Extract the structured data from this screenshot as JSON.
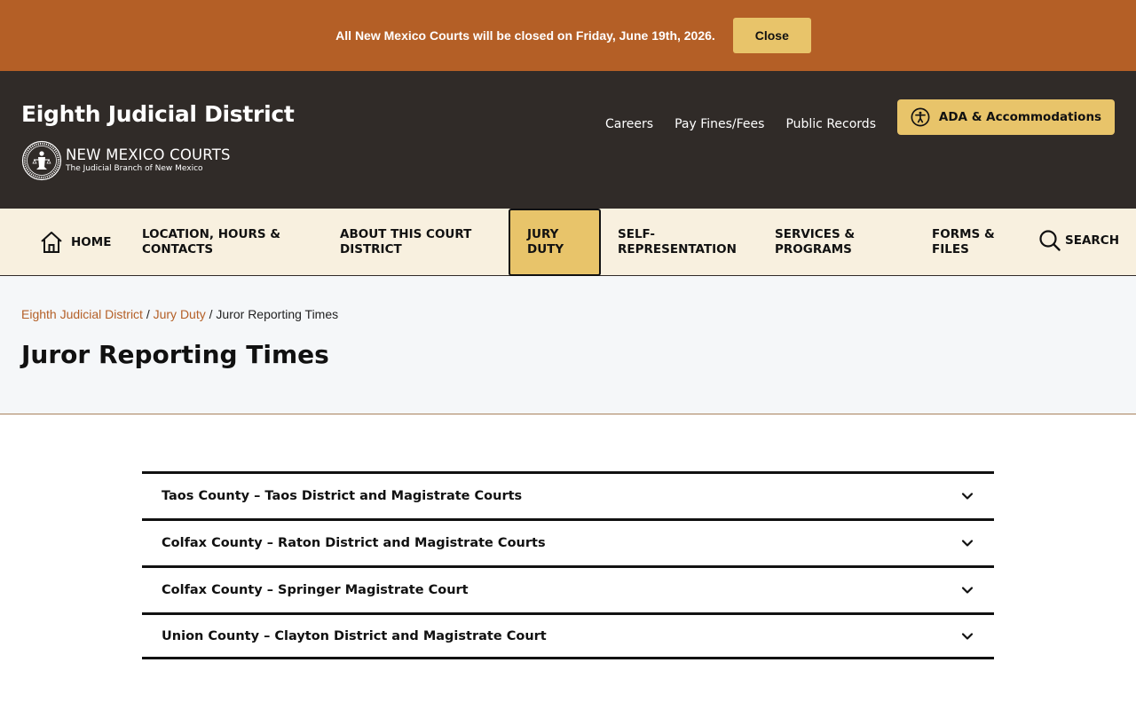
{
  "alert": {
    "message": "All New Mexico Courts will be closed on Friday, June 19th, 2026.",
    "close_label": "Close"
  },
  "header": {
    "site_title": "Eighth Judicial District",
    "logo_main": "NEW MEXICO COURTS",
    "logo_sub": "The Judicial Branch of New Mexico",
    "utility_links": [
      "Careers",
      "Pay Fines/Fees",
      "Public Records"
    ],
    "ada_label": "ADA & Accommodations"
  },
  "nav": {
    "home": "HOME",
    "location": [
      "LOCATION, HOURS &",
      "CONTACTS"
    ],
    "about": [
      "ABOUT THIS COURT",
      "DISTRICT"
    ],
    "jury": [
      "JURY",
      "DUTY"
    ],
    "self_rep": [
      "SELF-",
      "REPRESENTATION"
    ],
    "services": [
      "SERVICES &",
      "PROGRAMS"
    ],
    "forms": [
      "FORMS &",
      "FILES"
    ],
    "search": "SEARCH"
  },
  "breadcrumb": {
    "items": [
      "Eighth Judicial District",
      "Jury Duty"
    ],
    "separator": "/",
    "current": "Juror Reporting Times"
  },
  "page_title": "Juror Reporting Times",
  "accordion": [
    "Taos County – Taos District and Magistrate Courts",
    "Colfax County – Raton District and Magistrate Courts",
    "Colfax County – Springer Magistrate Court",
    "Union County – Clayton District and Magistrate Court"
  ],
  "colors": {
    "brand_orange": "#b45f26",
    "header_dark": "#302b28",
    "accent_gold": "#e8c46a",
    "nav_bg": "#f8f0df"
  }
}
